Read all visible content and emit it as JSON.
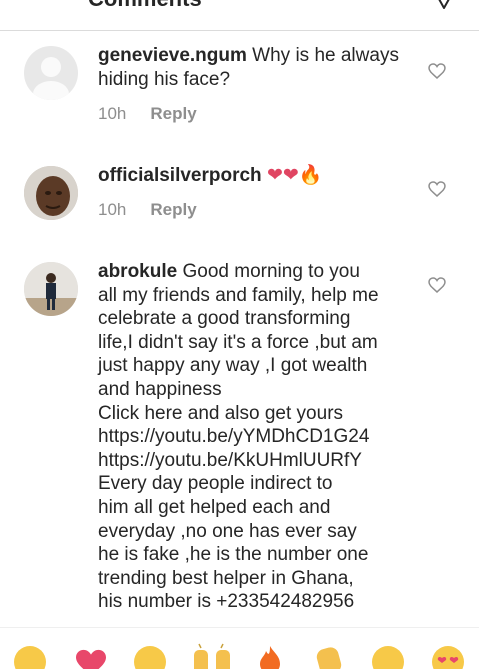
{
  "header": {
    "title": "Comments"
  },
  "comments": [
    {
      "username": "genevieve.ngum",
      "text": "Why is he always hiding his face?",
      "time": "10h",
      "reply": "Reply"
    },
    {
      "username": "officialsilverporch",
      "text": "❤❤🔥",
      "time": "10h",
      "reply": "Reply"
    },
    {
      "username": "abrokule",
      "lines": [
        "Good morning to you",
        "all my friends and family, help me",
        "celebrate a good transforming",
        "life,I didn't say it's a force ,but am",
        "just happy any way ,I got wealth",
        "and happiness",
        "Click here and also get yours",
        "https://youtu.be/yYMDhCD1G24",
        "https://youtu.be/KkUHmlUURfY",
        "Every day people indirect to",
        "him all get helped each and",
        "everyday ,no one has ever say",
        "he is fake ,he is the number one",
        "trending best helper in Ghana,",
        "his number is +233542482956"
      ]
    }
  ],
  "emoji_bar": [
    "laughing-face",
    "heart",
    "smiling-face",
    "raised-hands",
    "fire",
    "clapping-hands",
    "grinning-face",
    "heart-eyes-face"
  ]
}
